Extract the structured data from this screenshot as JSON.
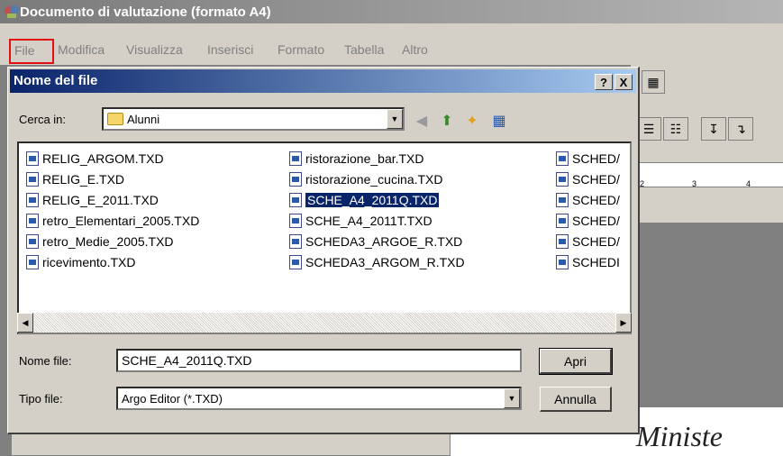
{
  "window": {
    "title": "Documento di valutazione (formato A4)"
  },
  "menu": {
    "items": [
      "File",
      "Modifica",
      "Visualizza",
      "Inserisci",
      "Formato",
      "Tabella",
      "Altro"
    ]
  },
  "dialog": {
    "title": "Nome del file",
    "help_btn": "?",
    "close_btn": "X",
    "lookin_label": "Cerca in:",
    "lookin_value": "Alunni",
    "files_col1": [
      "RELIG_ARGOM.TXD",
      "RELIG_E.TXD",
      "RELIG_E_2011.TXD",
      "retro_Elementari_2005.TXD",
      "retro_Medie_2005.TXD",
      "ricevimento.TXD"
    ],
    "files_col2": [
      "ristorazione_bar.TXD",
      "ristorazione_cucina.TXD",
      "SCHE_A4_2011Q.TXD",
      "SCHE_A4_2011T.TXD",
      "SCHEDA3_ARGOE_R.TXD",
      "SCHEDA3_ARGOM_R.TXD"
    ],
    "files_col3": [
      "SCHED/",
      "SCHED/",
      "SCHED/",
      "SCHED/",
      "SCHED/",
      "SCHEDI"
    ],
    "selected_file": "SCHE_A4_2011Q.TXD",
    "filename_label": "Nome file:",
    "filename_value": "SCHE_A4_2011Q.TXD",
    "filetype_label": "Tipo file:",
    "filetype_value": "Argo Editor (*.TXD)",
    "open_label": "Apri",
    "cancel_label": "Annulla"
  },
  "ruler": {
    "ticks": [
      "2",
      "3",
      "4"
    ]
  },
  "document": {
    "visible_text": "Ministe"
  },
  "colors": {
    "title_active": "#0a246a",
    "highlight_box": "#e01010",
    "face": "#d4d0c8"
  }
}
